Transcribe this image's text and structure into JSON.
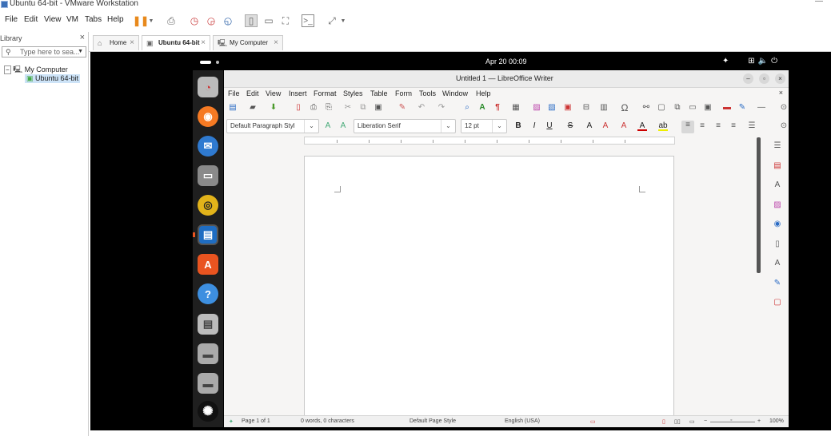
{
  "window": {
    "title": "Ubuntu 64-bit - VMware Workstation",
    "minimize": "—"
  },
  "host_menu": [
    "File",
    "Edit",
    "View",
    "VM",
    "Tabs",
    "Help"
  ],
  "library": {
    "title": "Library",
    "close": "×",
    "search_placeholder": "Type here to sea...",
    "tree": {
      "root": "My Computer",
      "child": "Ubuntu 64-bit"
    }
  },
  "tabs": [
    {
      "label": "Home"
    },
    {
      "label": "Ubuntu 64-bit"
    },
    {
      "label": "My Computer"
    }
  ],
  "ubuntu": {
    "clock": "Apr 20  00:09"
  },
  "libreoffice": {
    "title": "Untitled 1 — LibreOffice Writer",
    "menu": [
      "File",
      "Edit",
      "View",
      "Insert",
      "Format",
      "Styles",
      "Table",
      "Form",
      "Tools",
      "Window",
      "Help"
    ],
    "paragraph_style": "Default Paragraph Styl",
    "font_name": "Liberation Serif",
    "font_size": "12 pt",
    "status": {
      "page": "Page 1 of 1",
      "words": "0 words, 0 characters",
      "page_style": "Default Page Style",
      "language": "English (USA)",
      "zoom": "100%"
    }
  }
}
